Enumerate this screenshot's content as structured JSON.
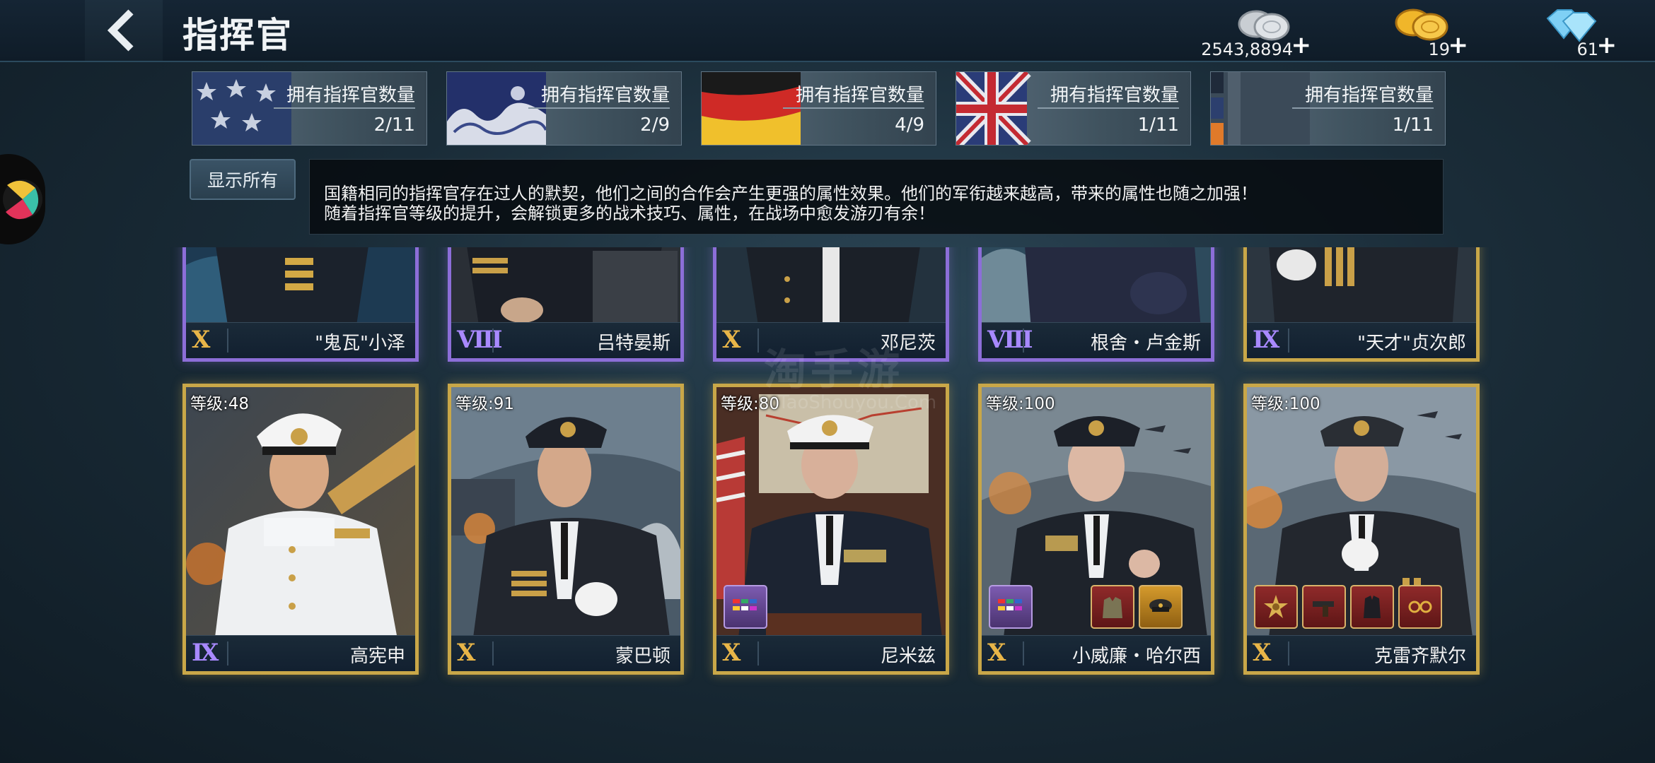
{
  "header": {
    "title": "指挥官",
    "back_icon": "chevron-left-icon",
    "currencies": [
      {
        "name": "silver",
        "icon": "silver-coins-icon",
        "amount": "2543,8894"
      },
      {
        "name": "gold",
        "icon": "gold-coins-icon",
        "amount": "19"
      },
      {
        "name": "diamond",
        "icon": "diamond-icon",
        "amount": "61"
      }
    ]
  },
  "nations": [
    {
      "flag": "usa-flag",
      "label": "拥有指挥官数量",
      "count": "2/11"
    },
    {
      "flag": "japan-wave-flag",
      "label": "拥有指挥官数量",
      "count": "2/9"
    },
    {
      "flag": "germany-flag",
      "label": "拥有指挥官数量",
      "count": "4/9"
    },
    {
      "flag": "uk-flag",
      "label": "拥有指挥官数量",
      "count": "1/11"
    },
    {
      "flag": "other-flag",
      "label": "拥有指挥官数量",
      "count": "1/11"
    }
  ],
  "filter": {
    "show_all_label": "显示所有"
  },
  "description": {
    "line1": "国籍相同的指挥官存在过人的默契，他们之间的合作会产生更强的属性效果。他们的军衔越来越高，带来的属性也随之加强！",
    "line2": "随着指挥官等级的提升，会解锁更多的战术技巧、属性，在战场中愈发游刃有余！"
  },
  "top_row": [
    {
      "rank": "X",
      "rank_color": "gold",
      "frame": "purple",
      "name": "\"鬼瓦\"小泽"
    },
    {
      "rank": "Ⅷ",
      "rank_color": "purple",
      "frame": "purple",
      "name": "吕特晏斯"
    },
    {
      "rank": "X",
      "rank_color": "gold",
      "frame": "purple",
      "name": "邓尼茨"
    },
    {
      "rank": "Ⅷ",
      "rank_color": "purple",
      "frame": "purple",
      "name": "根舍・卢金斯"
    },
    {
      "rank": "Ⅸ",
      "rank_color": "purple",
      "frame": "gold",
      "name": "\"天才\"贞次郎"
    }
  ],
  "bottom_row": [
    {
      "level": "等级:48",
      "rank": "Ⅸ",
      "rank_color": "purple",
      "name": "高宪申",
      "uniform": "white",
      "equipment": []
    },
    {
      "level": "等级:91",
      "rank": "X",
      "rank_color": "gold",
      "name": "蒙巴顿",
      "uniform": "navy",
      "equipment": []
    },
    {
      "level": "等级:80",
      "rank": "X",
      "rank_color": "gold",
      "name": "尼米兹",
      "uniform": "navy",
      "equipment": [
        "ribbon-bar-icon"
      ]
    },
    {
      "level": "等级:100",
      "rank": "X",
      "rank_color": "gold",
      "name": "小威廉・哈尔西",
      "uniform": "navy",
      "equipment": [
        "ribbon-bar-icon",
        "uniform-jacket-icon",
        "officer-cap-icon"
      ]
    },
    {
      "level": "等级:100",
      "rank": "X",
      "rank_color": "gold",
      "name": "克雷齐默尔",
      "uniform": "navy",
      "equipment": [
        "medal-icon",
        "pistol-icon",
        "coat-icon",
        "glasses-icon"
      ]
    }
  ],
  "watermark": {
    "main": "淘手游",
    "sub": "TaoShouyou.Com"
  },
  "colors": {
    "gold_frame": "#c9a748",
    "purple_frame": "#8c6ed8",
    "gold_rank": "#e8b548",
    "purple_rank": "#a889ff"
  }
}
